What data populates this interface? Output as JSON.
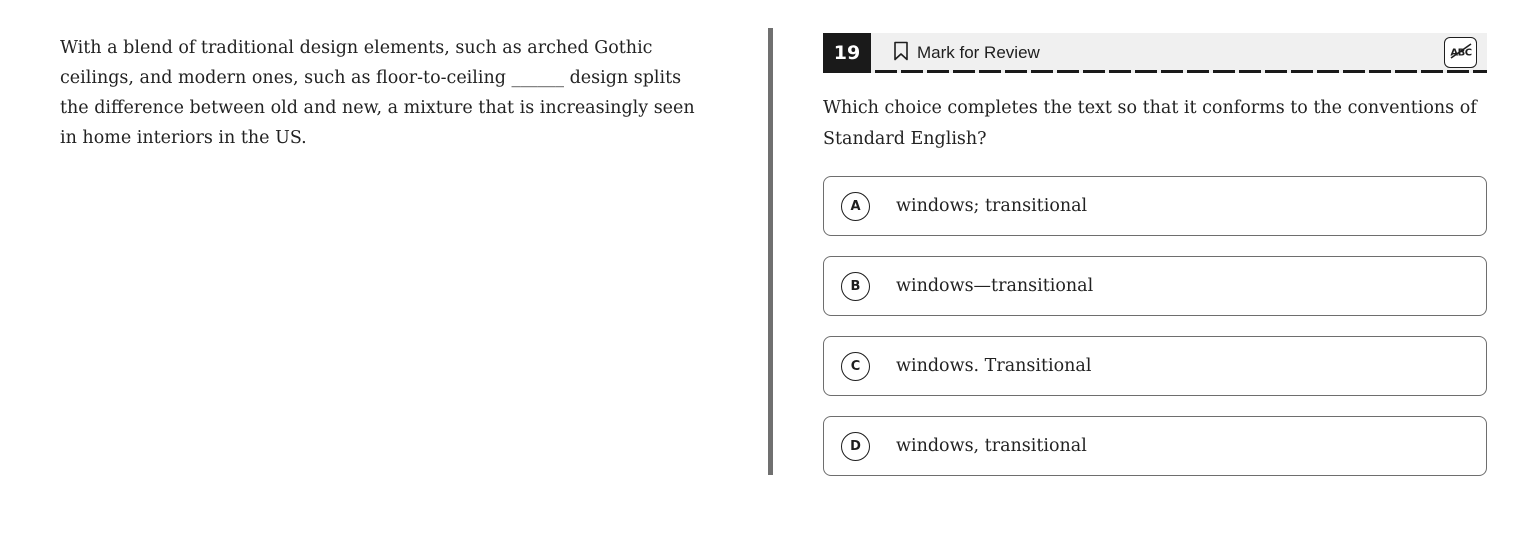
{
  "passage": {
    "text": "With a blend of traditional design elements, such as arched Gothic ceilings, and modern ones, such as floor-to-ceiling ______ design splits the difference between old and new, a mixture that is increasingly seen in home interiors in the US."
  },
  "question": {
    "number": "19",
    "mark_label": "Mark for Review",
    "abc_icon": "abc-strikethrough-icon",
    "prompt": "Which choice completes the text so that it conforms to the conventions of Standard English?",
    "options": [
      {
        "letter": "A",
        "text": "windows; transitional"
      },
      {
        "letter": "B",
        "text": "windows—transitional"
      },
      {
        "letter": "C",
        "text": "windows. Transitional"
      },
      {
        "letter": "D",
        "text": "windows, transitional"
      }
    ]
  },
  "colors": {
    "header_bg": "#f0f0f0",
    "number_bg": "#1a1a1a",
    "divider": "#707070",
    "border": "#6e6e6e"
  }
}
